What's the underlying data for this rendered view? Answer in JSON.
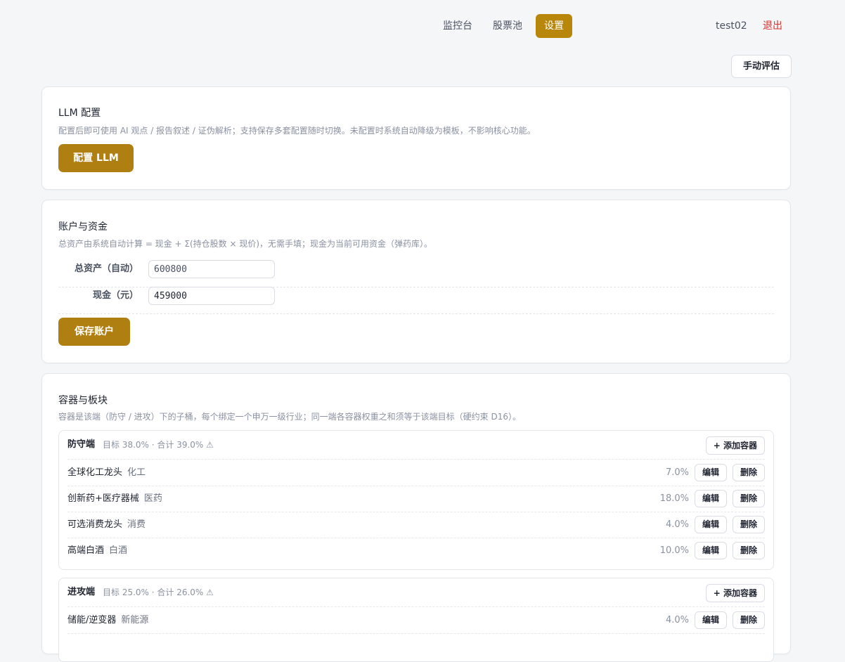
{
  "nav": {
    "items": [
      {
        "label": "监控台",
        "active": false
      },
      {
        "label": "股票池",
        "active": false
      },
      {
        "label": "设置",
        "active": true
      }
    ],
    "user": "test02",
    "logout": "退出",
    "accent_color": "#b7860b"
  },
  "toolbar": {
    "manual_eval_label": "手动评估"
  },
  "llm": {
    "title": "LLM 配置",
    "desc": "配置后即可使用 AI 观点 / 报告叙述 / 证伪解析；支持保存多套配置随时切换。未配置时系统自动降级为模板，不影响核心功能。",
    "button": "配置 LLM"
  },
  "account": {
    "title": "账户与资金",
    "desc": "总资产由系统自动计算 = 现金 + Σ(持仓股数 × 现价)，无需手填；现金为当前可用资金（弹药库）。",
    "total_label": "总资产（自动）",
    "total_value": "600800",
    "cash_label": "现金（元）",
    "cash_value": "459000",
    "save_button": "保存账户"
  },
  "containers": {
    "title": "容器与板块",
    "desc": "容器是该端（防守 / 进攻）下的子桶，每个绑定一个申万一级行业；同一端各容器权重之和须等于该端目标（硬约束 D16）。",
    "add_label": "+ 添加容器",
    "edit_label": "编辑",
    "delete_label": "删除",
    "groups": [
      {
        "name": "防守端",
        "meta": "目标 38.0% · 合计 39.0% ⚠",
        "items": [
          {
            "name": "全球化工龙头",
            "sector": "化工",
            "weight": "7.0%"
          },
          {
            "name": "创新药+医疗器械",
            "sector": "医药",
            "weight": "18.0%"
          },
          {
            "name": "可选消费龙头",
            "sector": "消费",
            "weight": "4.0%"
          },
          {
            "name": "高端白酒",
            "sector": "白酒",
            "weight": "10.0%"
          }
        ]
      },
      {
        "name": "进攻端",
        "meta": "目标 25.0% · 合计 26.0% ⚠",
        "items": [
          {
            "name": "储能/逆变器",
            "sector": "新能源",
            "weight": "4.0%"
          }
        ]
      }
    ]
  }
}
